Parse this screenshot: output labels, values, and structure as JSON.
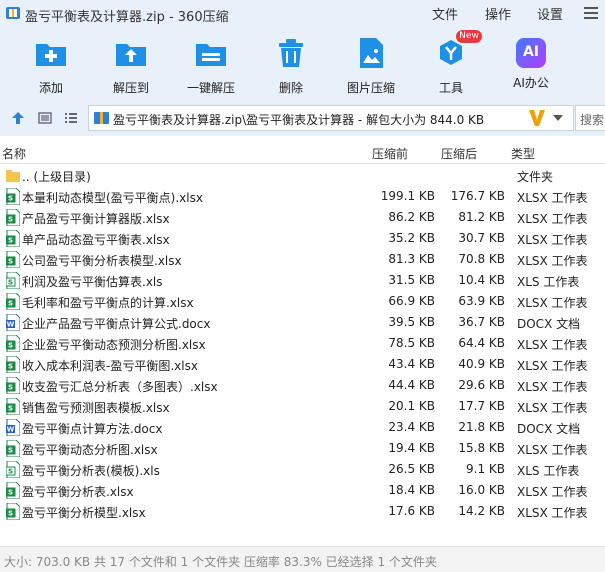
{
  "window": {
    "title": "盈亏平衡表及计算器.zip - 360压缩",
    "menu": [
      "文件",
      "操作",
      "设置"
    ]
  },
  "toolbar": {
    "items": [
      {
        "label": "添加",
        "icon": "add-icon"
      },
      {
        "label": "解压到",
        "icon": "extract-to-icon"
      },
      {
        "label": "一键解压",
        "icon": "one-click-extract-icon"
      },
      {
        "label": "删除",
        "icon": "trash-icon"
      },
      {
        "label": "图片压缩",
        "icon": "image-compress-icon"
      },
      {
        "label": "工具",
        "icon": "tools-icon",
        "badge": "New"
      },
      {
        "label": "AI办公",
        "icon": "ai-office-icon",
        "icon_text": "AI"
      }
    ]
  },
  "address": {
    "path": "盈亏平衡表及计算器.zip\\盈亏平衡表及计算器 - 解包大小为 844.0 KB",
    "search_placeholder": "搜索"
  },
  "columns": {
    "name": "名称",
    "compressed": "压缩前",
    "after": "压缩后",
    "type": "类型"
  },
  "files": [
    {
      "name": ".. (上级目录)",
      "before": "",
      "after": "",
      "type": "文件夹",
      "kind": "folder"
    },
    {
      "name": "本量利动态模型(盈亏平衡点).xlsx",
      "before": "199.1 KB",
      "after": "176.7 KB",
      "type": "XLSX 工作表",
      "kind": "xlsx"
    },
    {
      "name": "产品盈亏平衡计算器版.xlsx",
      "before": "86.2 KB",
      "after": "81.2 KB",
      "type": "XLSX 工作表",
      "kind": "xlsx"
    },
    {
      "name": "单产品动态盈亏平衡表.xlsx",
      "before": "35.2 KB",
      "after": "30.7 KB",
      "type": "XLSX 工作表",
      "kind": "xlsx"
    },
    {
      "name": "公司盈亏平衡分析表模型.xlsx",
      "before": "81.3 KB",
      "after": "70.8 KB",
      "type": "XLSX 工作表",
      "kind": "xlsx"
    },
    {
      "name": "利润及盈亏平衡估算表.xls",
      "before": "31.5 KB",
      "after": "10.4 KB",
      "type": "XLS 工作表",
      "kind": "xls"
    },
    {
      "name": "毛利率和盈亏平衡点的计算.xlsx",
      "before": "66.9 KB",
      "after": "63.9 KB",
      "type": "XLSX 工作表",
      "kind": "xlsx"
    },
    {
      "name": "企业产品盈亏平衡点计算公式.docx",
      "before": "39.5 KB",
      "after": "36.7 KB",
      "type": "DOCX 文档",
      "kind": "docx"
    },
    {
      "name": "企业盈亏平衡动态预测分析图.xlsx",
      "before": "78.5 KB",
      "after": "64.4 KB",
      "type": "XLSX 工作表",
      "kind": "xlsx"
    },
    {
      "name": "收入成本利润表-盈亏平衡图.xlsx",
      "before": "43.4 KB",
      "after": "40.9 KB",
      "type": "XLSX 工作表",
      "kind": "xlsx"
    },
    {
      "name": "收支盈亏汇总分析表（多图表）.xlsx",
      "before": "44.4 KB",
      "after": "29.6 KB",
      "type": "XLSX 工作表",
      "kind": "xlsx"
    },
    {
      "name": "销售盈亏预测图表模板.xlsx",
      "before": "20.1 KB",
      "after": "17.7 KB",
      "type": "XLSX 工作表",
      "kind": "xlsx"
    },
    {
      "name": "盈亏平衡点计算方法.docx",
      "before": "23.4 KB",
      "after": "21.8 KB",
      "type": "DOCX 文档",
      "kind": "docx"
    },
    {
      "name": "盈亏平衡动态分析图.xlsx",
      "before": "19.4 KB",
      "after": "15.8 KB",
      "type": "XLSX 工作表",
      "kind": "xlsx"
    },
    {
      "name": "盈亏平衡分析表(模板).xls",
      "before": "26.5 KB",
      "after": "9.1 KB",
      "type": "XLS 工作表",
      "kind": "xls"
    },
    {
      "name": "盈亏平衡分析表.xlsx",
      "before": "18.4 KB",
      "after": "16.0 KB",
      "type": "XLSX 工作表",
      "kind": "xlsx"
    },
    {
      "name": "盈亏平衡分析模型.xlsx",
      "before": "17.6 KB",
      "after": "14.2 KB",
      "type": "XLSX 工作表",
      "kind": "xlsx"
    }
  ],
  "status": "大小: 703.0 KB 共 17 个文件和 1 个文件夹 压缩率 83.3% 已经选择 1 个文件夹",
  "colors": {
    "accent": "#1e90e6",
    "chrome": "#e8f0f9",
    "excel_green": "#1d8a4a",
    "word_blue": "#2b5eb8",
    "folder_yellow": "#f5c451"
  }
}
